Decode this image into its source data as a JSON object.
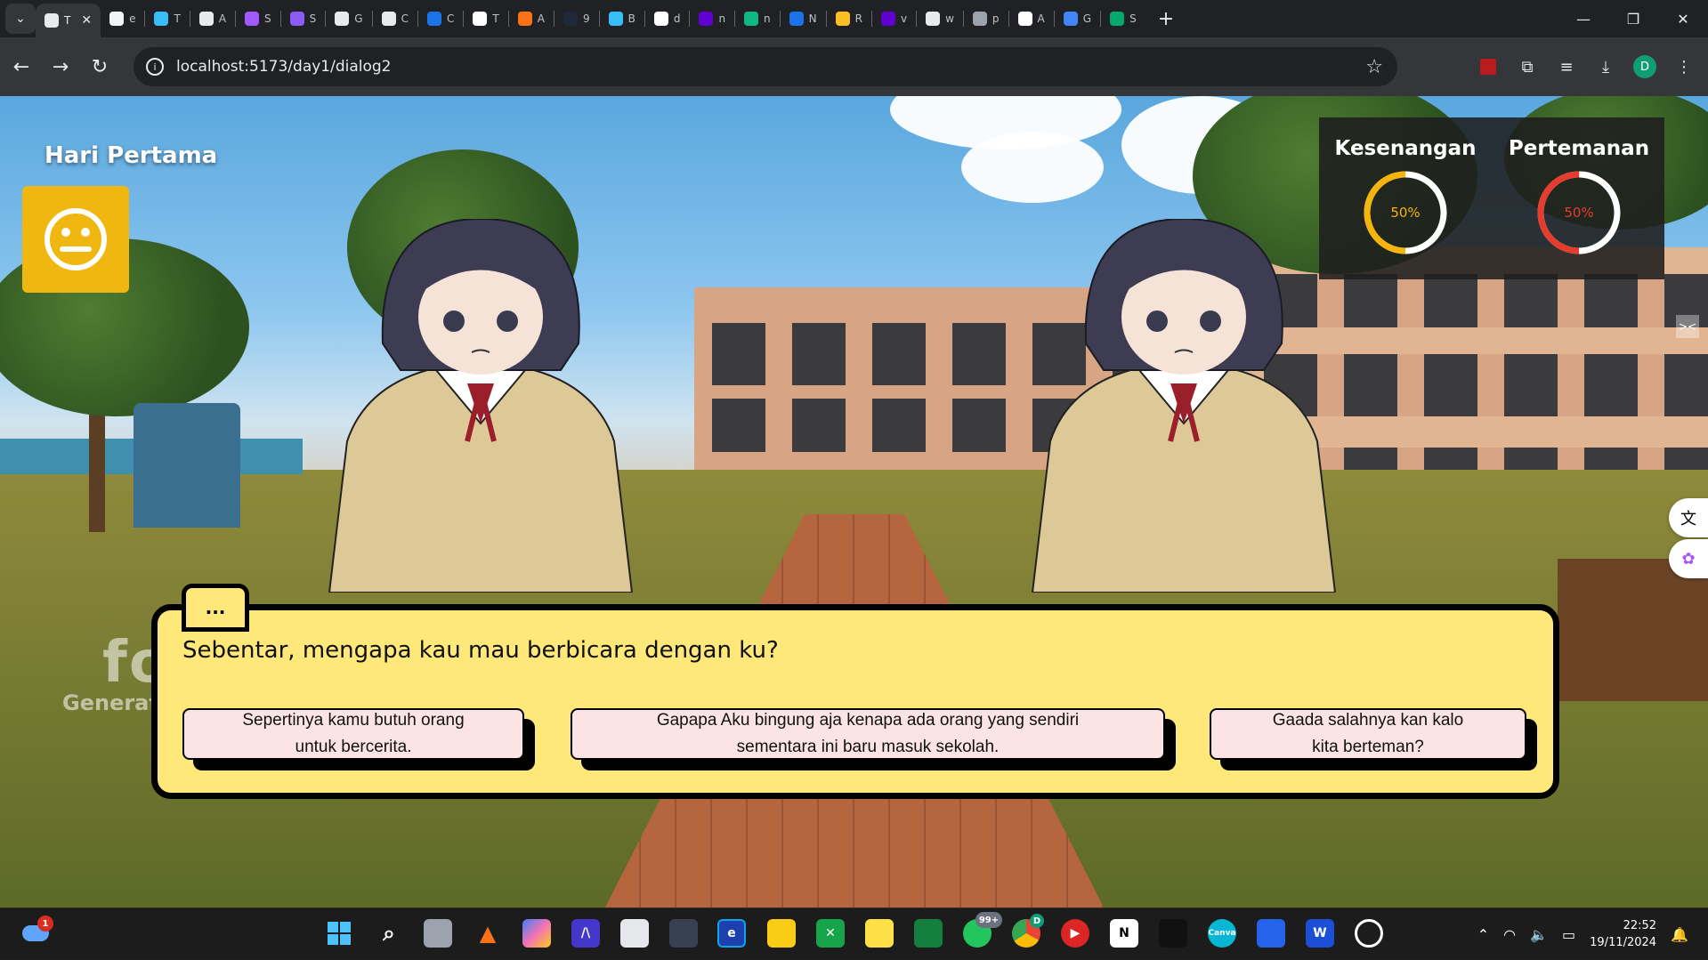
{
  "browser": {
    "tabs": [
      {
        "label": "T",
        "color": "#e8eaed",
        "active": true
      },
      {
        "label": "e",
        "color": "#f1f3f4"
      },
      {
        "label": "T",
        "color": "#38bdf8"
      },
      {
        "label": "A",
        "color": "#e8eaed"
      },
      {
        "label": "S",
        "color": "#a259ff"
      },
      {
        "label": "S",
        "color": "#8b5cf6"
      },
      {
        "label": "G",
        "color": "#e8eaed"
      },
      {
        "label": "C",
        "color": "#e8eaed"
      },
      {
        "label": "C",
        "color": "#1a73e8"
      },
      {
        "label": "T",
        "color": "#ffffff"
      },
      {
        "label": "A",
        "color": "#f97316"
      },
      {
        "label": "9",
        "color": "#1f2937"
      },
      {
        "label": "B",
        "color": "#38bdf8"
      },
      {
        "label": "d",
        "color": "#ffffff"
      },
      {
        "label": "n",
        "color": "#6001d2"
      },
      {
        "label": "n",
        "color": "#10b981"
      },
      {
        "label": "N",
        "color": "#1a73e8"
      },
      {
        "label": "R",
        "color": "#fbbf24"
      },
      {
        "label": "v",
        "color": "#6001d2"
      },
      {
        "label": "w",
        "color": "#e8eaed"
      },
      {
        "label": "p",
        "color": "#9ca3af"
      },
      {
        "label": "A",
        "color": "#ffffff"
      },
      {
        "label": "G",
        "color": "#4285f4"
      },
      {
        "label": "S",
        "color": "#04aa6d"
      }
    ],
    "url": "localhost:5173/day1/dialog2"
  },
  "game": {
    "day_title": "Hari Pertama",
    "stats": [
      {
        "label": "Kesenangan",
        "value": "50%",
        "fraction": 0.5,
        "color": "#f5b50a"
      },
      {
        "label": "Pertemanan",
        "value": "50%",
        "fraction": 0.5,
        "color": "#e63c2e"
      }
    ],
    "speaker": "...",
    "dialog_line": "Sebentar, mengapa kau mau berbicara dengan ku?",
    "choices": [
      {
        "line1": "Sepertinya kamu butuh orang",
        "line2": "untuk bercerita."
      },
      {
        "line1": "Gapapa Aku bingung aja kenapa ada orang yang sendiri",
        "line2": "sementara ini baru masuk sekolah."
      },
      {
        "line1": "Gaada salahnya kan kalo",
        "line2": "kita berteman?"
      }
    ],
    "watermark": {
      "logo": "fotor",
      "sub": "Generated with AI"
    }
  },
  "taskbar": {
    "weather_badge": "1",
    "whatsapp_badge": "99+",
    "chrome_badge": "D",
    "time": "22:52",
    "date": "19/11/2024"
  }
}
